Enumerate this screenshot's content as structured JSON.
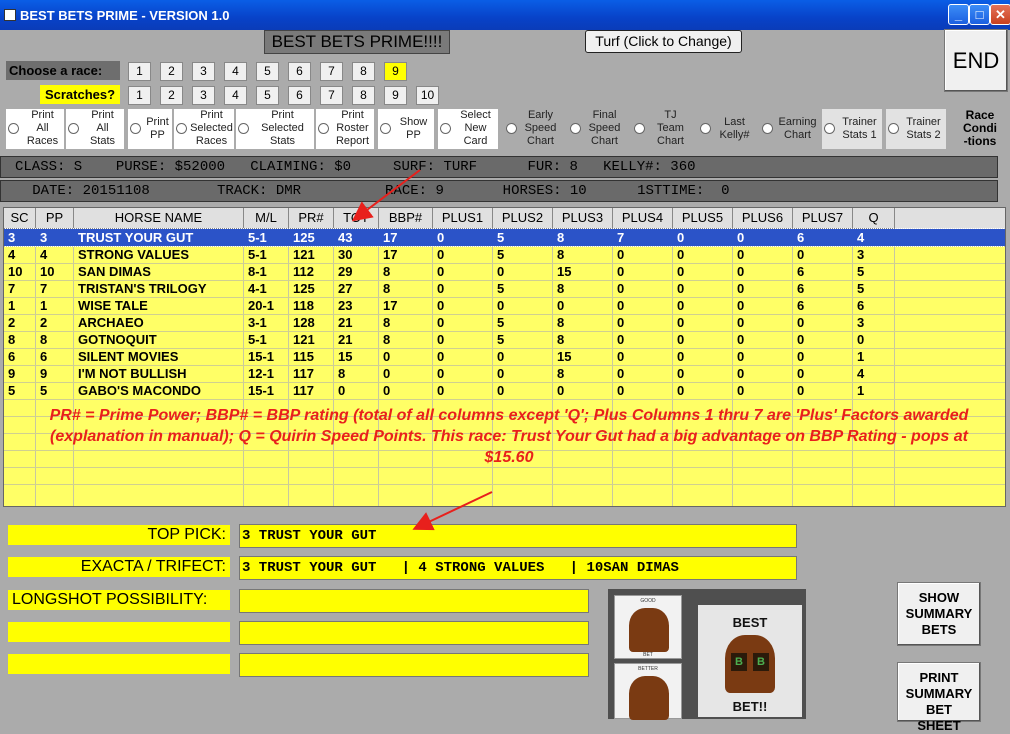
{
  "window": {
    "title": "BEST BETS PRIME - VERSION 1.0",
    "min": "_",
    "max": "□",
    "close": "✕"
  },
  "app_title": "BEST BETS PRIME!!!!",
  "turf_button": "Turf (Click to Change)",
  "end_button": "END",
  "choose_label": "Choose  a race:",
  "scratches_label": "Scratches?",
  "race_buttons": [
    "1",
    "2",
    "3",
    "4",
    "5",
    "6",
    "7",
    "8",
    "9"
  ],
  "race_selected": "9",
  "scratch_buttons": [
    "1",
    "2",
    "3",
    "4",
    "5",
    "6",
    "7",
    "8",
    "9",
    "10"
  ],
  "options": [
    "Print\nAll\nRaces",
    "Print\nAll\nStats",
    "Print\nPP",
    "Print\nSelected\nRaces",
    "Print\nSelected\nStats",
    "Print\nRoster\nReport",
    "Show\nPP",
    "Select\nNew\nCard",
    "Early\nSpeed\nChart",
    "Final\nSpeed\nChart",
    "TJ\nTeam\nChart",
    "Last\nKelly#",
    "Earning\nChart",
    "Trainer\nStats 1",
    "Trainer\nStats 2",
    "Race\nCondi\n-tions"
  ],
  "info1": "CLASS: S    PURSE: $52000   CLAIMING: $0     SURF: TURF      FUR: 8   KELLY#: 360",
  "info2": "   DATE: 20151108        TRACK: DMR          RACE: 9       HORSES: 10      1STTIME:  0",
  "table": {
    "headers": [
      "SC",
      "PP",
      "HORSE NAME",
      "M/L",
      "PR#",
      "TOT",
      "BBP#",
      "PLUS1",
      "PLUS2",
      "PLUS3",
      "PLUS4",
      "PLUS5",
      "PLUS6",
      "PLUS7",
      "Q"
    ],
    "rows": [
      [
        "3",
        "3",
        "TRUST YOUR GUT",
        "5-1",
        "125",
        "43",
        "17",
        "0",
        "5",
        "8",
        "7",
        "0",
        "0",
        "6",
        "4"
      ],
      [
        "4",
        "4",
        "STRONG VALUES",
        "5-1",
        "121",
        "30",
        "17",
        "0",
        "5",
        "8",
        "0",
        "0",
        "0",
        "0",
        "3"
      ],
      [
        "10",
        "10",
        "SAN DIMAS",
        "8-1",
        "112",
        "29",
        "8",
        "0",
        "0",
        "15",
        "0",
        "0",
        "0",
        "6",
        "5"
      ],
      [
        "7",
        "7",
        "TRISTAN'S TRILOGY",
        "4-1",
        "125",
        "27",
        "8",
        "0",
        "5",
        "8",
        "0",
        "0",
        "0",
        "6",
        "5"
      ],
      [
        "1",
        "1",
        "WISE TALE",
        "20-1",
        "118",
        "23",
        "17",
        "0",
        "0",
        "0",
        "0",
        "0",
        "0",
        "6",
        "6"
      ],
      [
        "2",
        "2",
        "ARCHAEO",
        "3-1",
        "128",
        "21",
        "8",
        "0",
        "5",
        "8",
        "0",
        "0",
        "0",
        "0",
        "3"
      ],
      [
        "8",
        "8",
        "GOTNOQUIT",
        "5-1",
        "121",
        "21",
        "8",
        "0",
        "5",
        "8",
        "0",
        "0",
        "0",
        "0",
        "0"
      ],
      [
        "6",
        "6",
        "SILENT MOVIES",
        "15-1",
        "115",
        "15",
        "0",
        "0",
        "0",
        "15",
        "0",
        "0",
        "0",
        "0",
        "1"
      ],
      [
        "9",
        "9",
        "I'M NOT BULLISH",
        "12-1",
        "117",
        "8",
        "0",
        "0",
        "0",
        "8",
        "0",
        "0",
        "0",
        "0",
        "4"
      ],
      [
        "5",
        "5",
        "GABO'S MACONDO",
        "15-1",
        "117",
        "0",
        "0",
        "0",
        "0",
        "0",
        "0",
        "0",
        "0",
        "0",
        "1"
      ]
    ]
  },
  "note": "PR# = Prime Power; BBP# = BBP rating (total of all columns except 'Q'; Plus Columns 1 thru 7 are 'Plus' Factors awarded (explanation in manual); Q = Quirin Speed Points.  This race: Trust Your Gut had a big advantage on BBP Rating - pops at $15.60",
  "picks": {
    "top_pick_label": "TOP PICK:",
    "top_pick_value": "3 TRUST YOUR GUT",
    "exacta_label": "EXACTA / TRIFECT:",
    "exacta_value": "3 TRUST YOUR GUT   | 4 STRONG VALUES   | 10SAN DIMAS",
    "longshot_label": "LONGSHOT POSSIBILITY:",
    "longshot_value": ""
  },
  "logo": {
    "good": "GOOD",
    "bet": "BET",
    "better": "BETTER",
    "best": "BEST",
    "bet_excl": "BET!!",
    "b": "B"
  },
  "show_summary": "SHOW\nSUMMARY\nBETS",
  "print_summary": "PRINT\nSUMMARY\nBET\nSHEET",
  "colors": {
    "highlight": "#ffff00",
    "grid": "#ffff66",
    "selection": "#2b53c8",
    "annotation": "#e8201c"
  }
}
